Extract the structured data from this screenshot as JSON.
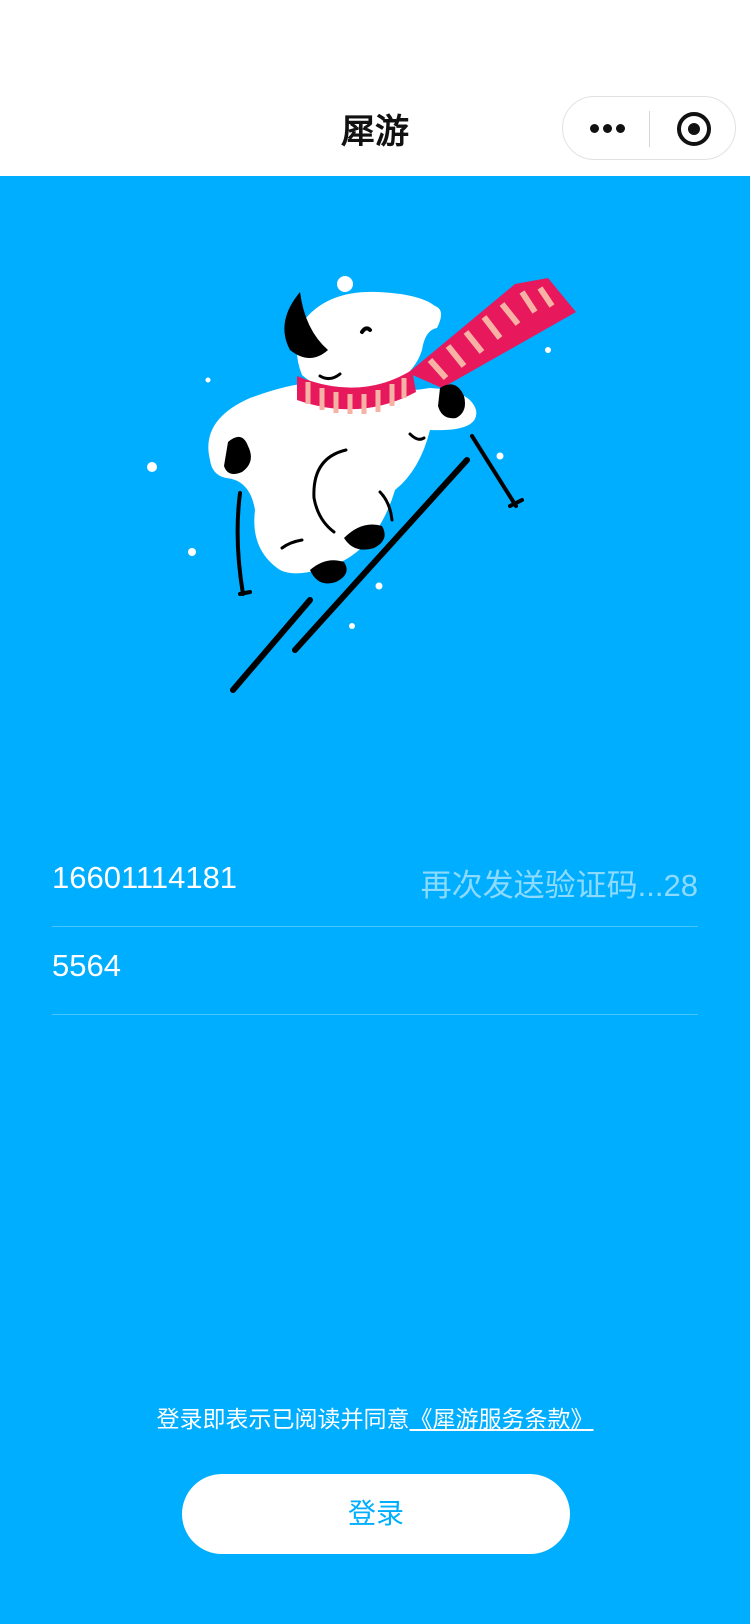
{
  "nav": {
    "title": "犀游",
    "more_icon": "more-dots-icon",
    "close_icon": "target-circle-icon"
  },
  "illustration": {
    "icon": "skiing-rhino-illustration"
  },
  "form": {
    "phone_value": "16601114181",
    "resend_text": "再次发送验证码...28",
    "code_value": "5564"
  },
  "agreement": {
    "prefix": "登录即表示已阅读并同意",
    "link": "《犀游服务条款》"
  },
  "login_button": {
    "label": "登录"
  },
  "colors": {
    "background": "#00aeff",
    "scarf_red": "#e8185c",
    "scarf_pink": "#f7b2a6"
  }
}
